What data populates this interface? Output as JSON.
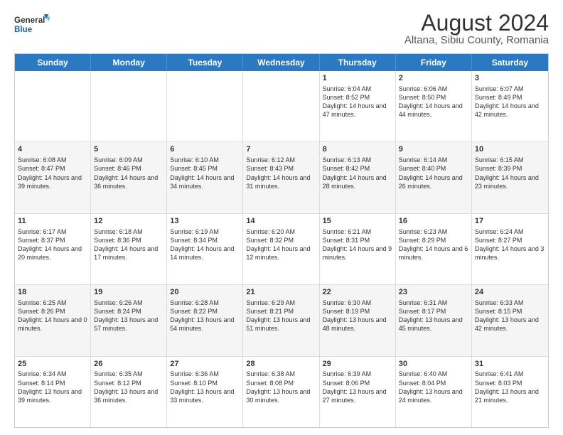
{
  "logo": {
    "line1": "General",
    "line2": "Blue"
  },
  "title": "August 2024",
  "subtitle": "Altana, Sibiu County, Romania",
  "weekdays": [
    "Sunday",
    "Monday",
    "Tuesday",
    "Wednesday",
    "Thursday",
    "Friday",
    "Saturday"
  ],
  "rows": [
    [
      {
        "day": "",
        "text": ""
      },
      {
        "day": "",
        "text": ""
      },
      {
        "day": "",
        "text": ""
      },
      {
        "day": "",
        "text": ""
      },
      {
        "day": "1",
        "text": "Sunrise: 6:04 AM\nSunset: 8:52 PM\nDaylight: 14 hours and 47 minutes."
      },
      {
        "day": "2",
        "text": "Sunrise: 6:06 AM\nSunset: 8:50 PM\nDaylight: 14 hours and 44 minutes."
      },
      {
        "day": "3",
        "text": "Sunrise: 6:07 AM\nSunset: 8:49 PM\nDaylight: 14 hours and 42 minutes."
      }
    ],
    [
      {
        "day": "4",
        "text": "Sunrise: 6:08 AM\nSunset: 8:47 PM\nDaylight: 14 hours and 39 minutes."
      },
      {
        "day": "5",
        "text": "Sunrise: 6:09 AM\nSunset: 8:46 PM\nDaylight: 14 hours and 36 minutes."
      },
      {
        "day": "6",
        "text": "Sunrise: 6:10 AM\nSunset: 8:45 PM\nDaylight: 14 hours and 34 minutes."
      },
      {
        "day": "7",
        "text": "Sunrise: 6:12 AM\nSunset: 8:43 PM\nDaylight: 14 hours and 31 minutes."
      },
      {
        "day": "8",
        "text": "Sunrise: 6:13 AM\nSunset: 8:42 PM\nDaylight: 14 hours and 28 minutes."
      },
      {
        "day": "9",
        "text": "Sunrise: 6:14 AM\nSunset: 8:40 PM\nDaylight: 14 hours and 26 minutes."
      },
      {
        "day": "10",
        "text": "Sunrise: 6:15 AM\nSunset: 8:39 PM\nDaylight: 14 hours and 23 minutes."
      }
    ],
    [
      {
        "day": "11",
        "text": "Sunrise: 6:17 AM\nSunset: 8:37 PM\nDaylight: 14 hours and 20 minutes."
      },
      {
        "day": "12",
        "text": "Sunrise: 6:18 AM\nSunset: 8:36 PM\nDaylight: 14 hours and 17 minutes."
      },
      {
        "day": "13",
        "text": "Sunrise: 6:19 AM\nSunset: 8:34 PM\nDaylight: 14 hours and 14 minutes."
      },
      {
        "day": "14",
        "text": "Sunrise: 6:20 AM\nSunset: 8:32 PM\nDaylight: 14 hours and 12 minutes."
      },
      {
        "day": "15",
        "text": "Sunrise: 6:21 AM\nSunset: 8:31 PM\nDaylight: 14 hours and 9 minutes."
      },
      {
        "day": "16",
        "text": "Sunrise: 6:23 AM\nSunset: 8:29 PM\nDaylight: 14 hours and 6 minutes."
      },
      {
        "day": "17",
        "text": "Sunrise: 6:24 AM\nSunset: 8:27 PM\nDaylight: 14 hours and 3 minutes."
      }
    ],
    [
      {
        "day": "18",
        "text": "Sunrise: 6:25 AM\nSunset: 8:26 PM\nDaylight: 14 hours and 0 minutes."
      },
      {
        "day": "19",
        "text": "Sunrise: 6:26 AM\nSunset: 8:24 PM\nDaylight: 13 hours and 57 minutes."
      },
      {
        "day": "20",
        "text": "Sunrise: 6:28 AM\nSunset: 8:22 PM\nDaylight: 13 hours and 54 minutes."
      },
      {
        "day": "21",
        "text": "Sunrise: 6:29 AM\nSunset: 8:21 PM\nDaylight: 13 hours and 51 minutes."
      },
      {
        "day": "22",
        "text": "Sunrise: 6:30 AM\nSunset: 8:19 PM\nDaylight: 13 hours and 48 minutes."
      },
      {
        "day": "23",
        "text": "Sunrise: 6:31 AM\nSunset: 8:17 PM\nDaylight: 13 hours and 45 minutes."
      },
      {
        "day": "24",
        "text": "Sunrise: 6:33 AM\nSunset: 8:15 PM\nDaylight: 13 hours and 42 minutes."
      }
    ],
    [
      {
        "day": "25",
        "text": "Sunrise: 6:34 AM\nSunset: 8:14 PM\nDaylight: 13 hours and 39 minutes."
      },
      {
        "day": "26",
        "text": "Sunrise: 6:35 AM\nSunset: 8:12 PM\nDaylight: 13 hours and 36 minutes."
      },
      {
        "day": "27",
        "text": "Sunrise: 6:36 AM\nSunset: 8:10 PM\nDaylight: 13 hours and 33 minutes."
      },
      {
        "day": "28",
        "text": "Sunrise: 6:38 AM\nSunset: 8:08 PM\nDaylight: 13 hours and 30 minutes."
      },
      {
        "day": "29",
        "text": "Sunrise: 6:39 AM\nSunset: 8:06 PM\nDaylight: 13 hours and 27 minutes."
      },
      {
        "day": "30",
        "text": "Sunrise: 6:40 AM\nSunset: 8:04 PM\nDaylight: 13 hours and 24 minutes."
      },
      {
        "day": "31",
        "text": "Sunrise: 6:41 AM\nSunset: 8:03 PM\nDaylight: 13 hours and 21 minutes."
      }
    ]
  ]
}
